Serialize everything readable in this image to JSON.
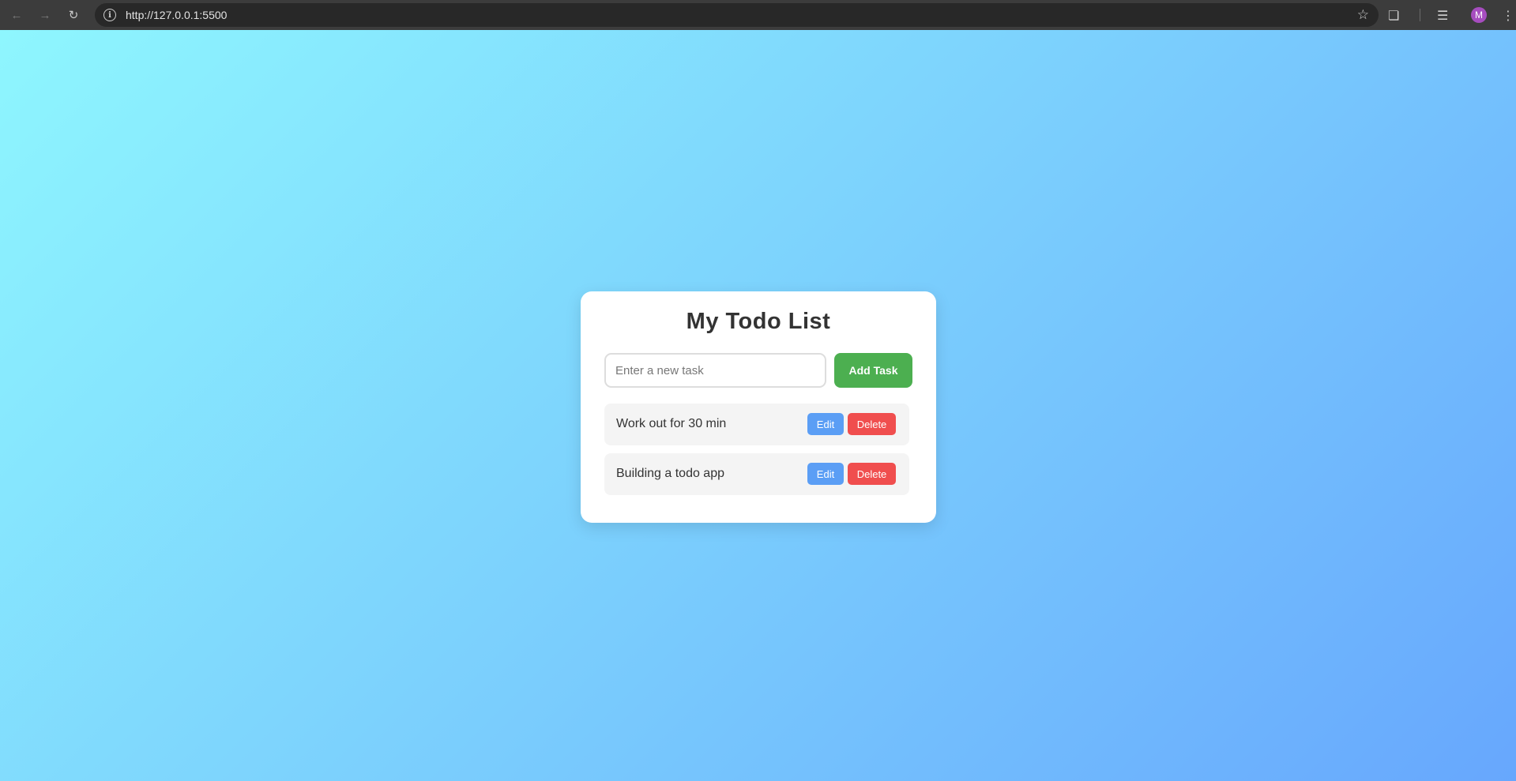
{
  "browser": {
    "url": "http://127.0.0.1:5500",
    "back_icon": "arrow-left-icon",
    "forward_icon": "arrow-right-icon",
    "reload_icon": "reload-icon",
    "avatar_letter": "M",
    "avatar_color": "#a64dbf"
  },
  "app": {
    "title": "My Todo List",
    "input_placeholder": "Enter a new task",
    "input_value": "",
    "add_label": "Add Task",
    "tasks": [
      {
        "text": "Work out for 30 min",
        "edit_label": "Edit",
        "delete_label": "Delete"
      },
      {
        "text": "Building a todo app",
        "edit_label": "Edit",
        "delete_label": "Delete"
      }
    ]
  },
  "colors": {
    "add_button": "#4caf50",
    "edit_button": "#5b9ef5",
    "delete_button": "#f04e4e",
    "gradient_start": "#8ef6fe",
    "gradient_end": "#67a7fd"
  }
}
